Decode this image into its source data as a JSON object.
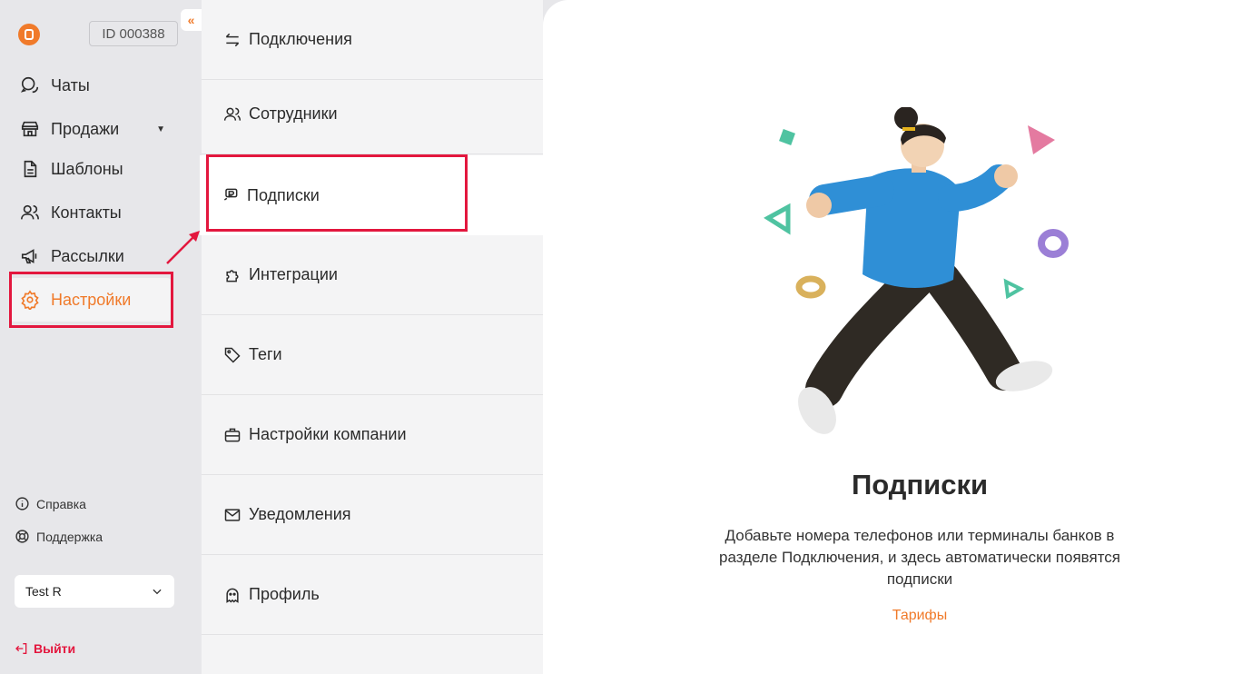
{
  "sidebar": {
    "id_badge": "ID 000388",
    "collapse_icon": "«",
    "items": [
      {
        "label": "Чаты",
        "icon": "chat-icon"
      },
      {
        "label": "Продажи",
        "icon": "store-icon"
      },
      {
        "label": "Шаблоны",
        "icon": "document-icon"
      },
      {
        "label": "Контакты",
        "icon": "users-icon"
      },
      {
        "label": "Рассылки",
        "icon": "megaphone-icon"
      },
      {
        "label": "Настройки",
        "icon": "gear-icon",
        "active": true
      }
    ],
    "help": "Справка",
    "support": "Поддержка",
    "account_select": "Test R",
    "logout": "Выйти"
  },
  "settings_menu": {
    "items": [
      {
        "label": "Подключения",
        "icon": "arrows-swap-icon"
      },
      {
        "label": "Сотрудники",
        "icon": "users-icon"
      },
      {
        "label": "Подписки",
        "icon": "subscription-icon",
        "active": true
      },
      {
        "label": "Интеграции",
        "icon": "puzzle-icon"
      },
      {
        "label": "Теги",
        "icon": "tag-icon"
      },
      {
        "label": "Настройки компании",
        "icon": "briefcase-icon"
      },
      {
        "label": "Уведомления",
        "icon": "mail-icon"
      },
      {
        "label": "Профиль",
        "icon": "ghost-icon"
      }
    ]
  },
  "content": {
    "title": "Подписки",
    "description": "Добавьте номера телефонов или терминалы банков в разделе Подключения, и здесь автоматически появятся подписки",
    "tariffs_link": "Тарифы"
  },
  "colors": {
    "accent": "#f07a2a",
    "highlight": "#e3173e",
    "sidebar_bg": "#e7e7ea",
    "menu_bg": "#f4f4f5"
  }
}
